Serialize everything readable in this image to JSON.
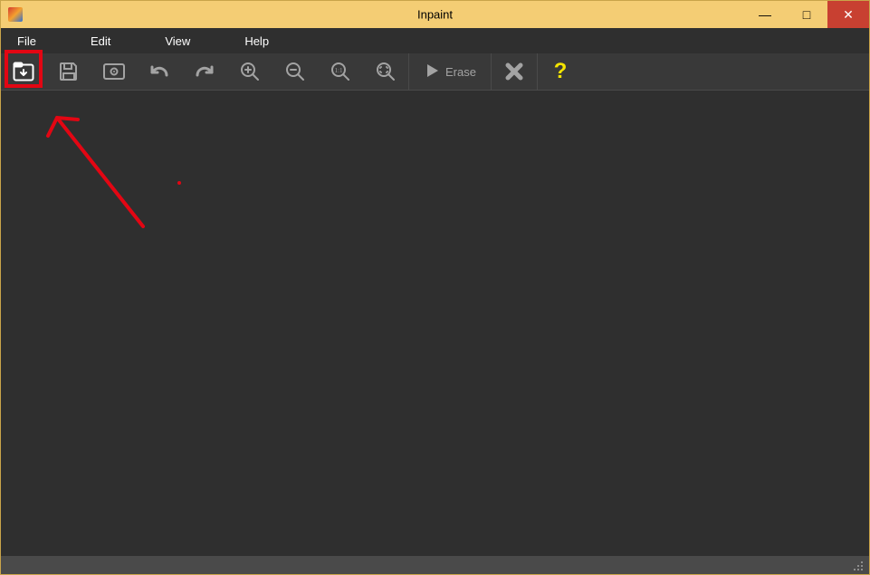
{
  "window": {
    "title": "Inpaint"
  },
  "title_controls": {
    "minimize_glyph": "—",
    "maximize_glyph": "□",
    "close_glyph": "✕"
  },
  "menu": {
    "file": "File",
    "edit": "Edit",
    "view": "View",
    "help": "Help"
  },
  "toolbar": {
    "erase_label": "Erase",
    "help_glyph": "?"
  },
  "icons": {
    "open": "open-file-icon",
    "save": "save-icon",
    "view_original": "view-original-icon",
    "undo": "undo-icon",
    "redo": "redo-icon",
    "zoom_in": "zoom-in-icon",
    "zoom_out": "zoom-out-icon",
    "zoom_actual": "zoom-actual-icon",
    "zoom_fit": "zoom-fit-icon",
    "play": "play-icon",
    "cancel": "cancel-icon",
    "help": "help-icon"
  },
  "colors": {
    "titlebar_bg": "#f4cd74",
    "close_bg": "#c84031",
    "menu_bg": "#2f2f2f",
    "toolbar_bg": "#393939",
    "canvas_bg": "#2f2f2f",
    "icon_color": "#a3a3a3",
    "highlight_red": "#e30613",
    "help_yellow": "#f4e400"
  }
}
